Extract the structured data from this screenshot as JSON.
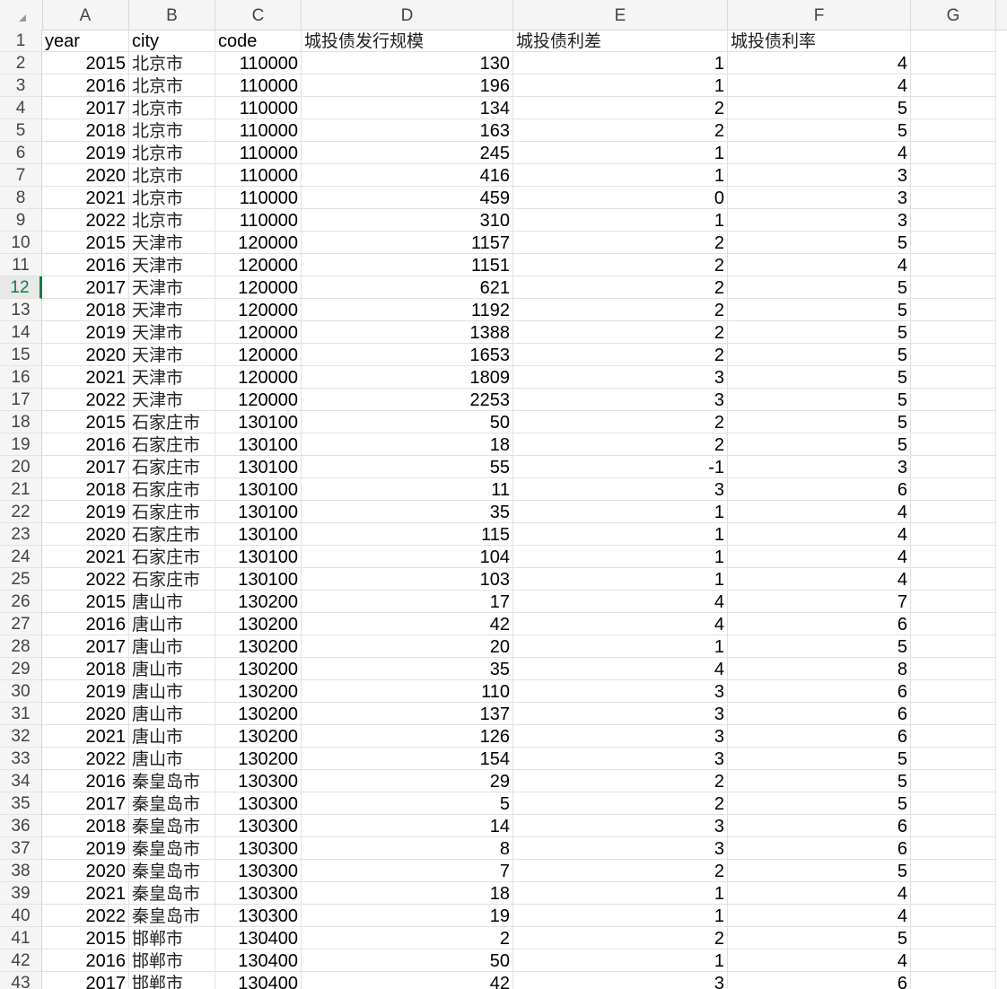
{
  "sheet": {
    "columns": [
      "A",
      "B",
      "C",
      "D",
      "E",
      "F",
      "G"
    ],
    "headers": [
      "year",
      "city",
      "code",
      "城投债发行规模",
      "城投债利差",
      "城投债利率"
    ],
    "active_row": "12",
    "rows": [
      {
        "n": "2",
        "c": [
          "2015",
          "北京市",
          "110000",
          "130",
          "1",
          "4"
        ]
      },
      {
        "n": "3",
        "c": [
          "2016",
          "北京市",
          "110000",
          "196",
          "1",
          "4"
        ]
      },
      {
        "n": "4",
        "c": [
          "2017",
          "北京市",
          "110000",
          "134",
          "2",
          "5"
        ]
      },
      {
        "n": "5",
        "c": [
          "2018",
          "北京市",
          "110000",
          "163",
          "2",
          "5"
        ]
      },
      {
        "n": "6",
        "c": [
          "2019",
          "北京市",
          "110000",
          "245",
          "1",
          "4"
        ]
      },
      {
        "n": "7",
        "c": [
          "2020",
          "北京市",
          "110000",
          "416",
          "1",
          "3"
        ]
      },
      {
        "n": "8",
        "c": [
          "2021",
          "北京市",
          "110000",
          "459",
          "0",
          "3"
        ]
      },
      {
        "n": "9",
        "c": [
          "2022",
          "北京市",
          "110000",
          "310",
          "1",
          "3"
        ]
      },
      {
        "n": "10",
        "c": [
          "2015",
          "天津市",
          "120000",
          "1157",
          "2",
          "5"
        ]
      },
      {
        "n": "11",
        "c": [
          "2016",
          "天津市",
          "120000",
          "1151",
          "2",
          "4"
        ]
      },
      {
        "n": "12",
        "c": [
          "2017",
          "天津市",
          "120000",
          "621",
          "2",
          "5"
        ]
      },
      {
        "n": "13",
        "c": [
          "2018",
          "天津市",
          "120000",
          "1192",
          "2",
          "5"
        ]
      },
      {
        "n": "14",
        "c": [
          "2019",
          "天津市",
          "120000",
          "1388",
          "2",
          "5"
        ]
      },
      {
        "n": "15",
        "c": [
          "2020",
          "天津市",
          "120000",
          "1653",
          "2",
          "5"
        ]
      },
      {
        "n": "16",
        "c": [
          "2021",
          "天津市",
          "120000",
          "1809",
          "3",
          "5"
        ]
      },
      {
        "n": "17",
        "c": [
          "2022",
          "天津市",
          "120000",
          "2253",
          "3",
          "5"
        ]
      },
      {
        "n": "18",
        "c": [
          "2015",
          "石家庄市",
          "130100",
          "50",
          "2",
          "5"
        ]
      },
      {
        "n": "19",
        "c": [
          "2016",
          "石家庄市",
          "130100",
          "18",
          "2",
          "5"
        ]
      },
      {
        "n": "20",
        "c": [
          "2017",
          "石家庄市",
          "130100",
          "55",
          "-1",
          "3"
        ]
      },
      {
        "n": "21",
        "c": [
          "2018",
          "石家庄市",
          "130100",
          "11",
          "3",
          "6"
        ]
      },
      {
        "n": "22",
        "c": [
          "2019",
          "石家庄市",
          "130100",
          "35",
          "1",
          "4"
        ]
      },
      {
        "n": "23",
        "c": [
          "2020",
          "石家庄市",
          "130100",
          "115",
          "1",
          "4"
        ]
      },
      {
        "n": "24",
        "c": [
          "2021",
          "石家庄市",
          "130100",
          "104",
          "1",
          "4"
        ]
      },
      {
        "n": "25",
        "c": [
          "2022",
          "石家庄市",
          "130100",
          "103",
          "1",
          "4"
        ]
      },
      {
        "n": "26",
        "c": [
          "2015",
          "唐山市",
          "130200",
          "17",
          "4",
          "7"
        ]
      },
      {
        "n": "27",
        "c": [
          "2016",
          "唐山市",
          "130200",
          "42",
          "4",
          "6"
        ]
      },
      {
        "n": "28",
        "c": [
          "2017",
          "唐山市",
          "130200",
          "20",
          "1",
          "5"
        ]
      },
      {
        "n": "29",
        "c": [
          "2018",
          "唐山市",
          "130200",
          "35",
          "4",
          "8"
        ]
      },
      {
        "n": "30",
        "c": [
          "2019",
          "唐山市",
          "130200",
          "110",
          "3",
          "6"
        ]
      },
      {
        "n": "31",
        "c": [
          "2020",
          "唐山市",
          "130200",
          "137",
          "3",
          "6"
        ]
      },
      {
        "n": "32",
        "c": [
          "2021",
          "唐山市",
          "130200",
          "126",
          "3",
          "6"
        ]
      },
      {
        "n": "33",
        "c": [
          "2022",
          "唐山市",
          "130200",
          "154",
          "3",
          "5"
        ]
      },
      {
        "n": "34",
        "c": [
          "2016",
          "秦皇岛市",
          "130300",
          "29",
          "2",
          "5"
        ]
      },
      {
        "n": "35",
        "c": [
          "2017",
          "秦皇岛市",
          "130300",
          "5",
          "2",
          "5"
        ]
      },
      {
        "n": "36",
        "c": [
          "2018",
          "秦皇岛市",
          "130300",
          "14",
          "3",
          "6"
        ]
      },
      {
        "n": "37",
        "c": [
          "2019",
          "秦皇岛市",
          "130300",
          "8",
          "3",
          "6"
        ]
      },
      {
        "n": "38",
        "c": [
          "2020",
          "秦皇岛市",
          "130300",
          "7",
          "2",
          "5"
        ]
      },
      {
        "n": "39",
        "c": [
          "2021",
          "秦皇岛市",
          "130300",
          "18",
          "1",
          "4"
        ]
      },
      {
        "n": "40",
        "c": [
          "2022",
          "秦皇岛市",
          "130300",
          "19",
          "1",
          "4"
        ]
      },
      {
        "n": "41",
        "c": [
          "2015",
          "邯郸市",
          "130400",
          "2",
          "2",
          "5"
        ]
      },
      {
        "n": "42",
        "c": [
          "2016",
          "邯郸市",
          "130400",
          "50",
          "1",
          "4"
        ]
      },
      {
        "n": "43",
        "c": [
          "2017",
          "邯郸市",
          "130400",
          "42",
          "3",
          "6"
        ]
      }
    ]
  }
}
